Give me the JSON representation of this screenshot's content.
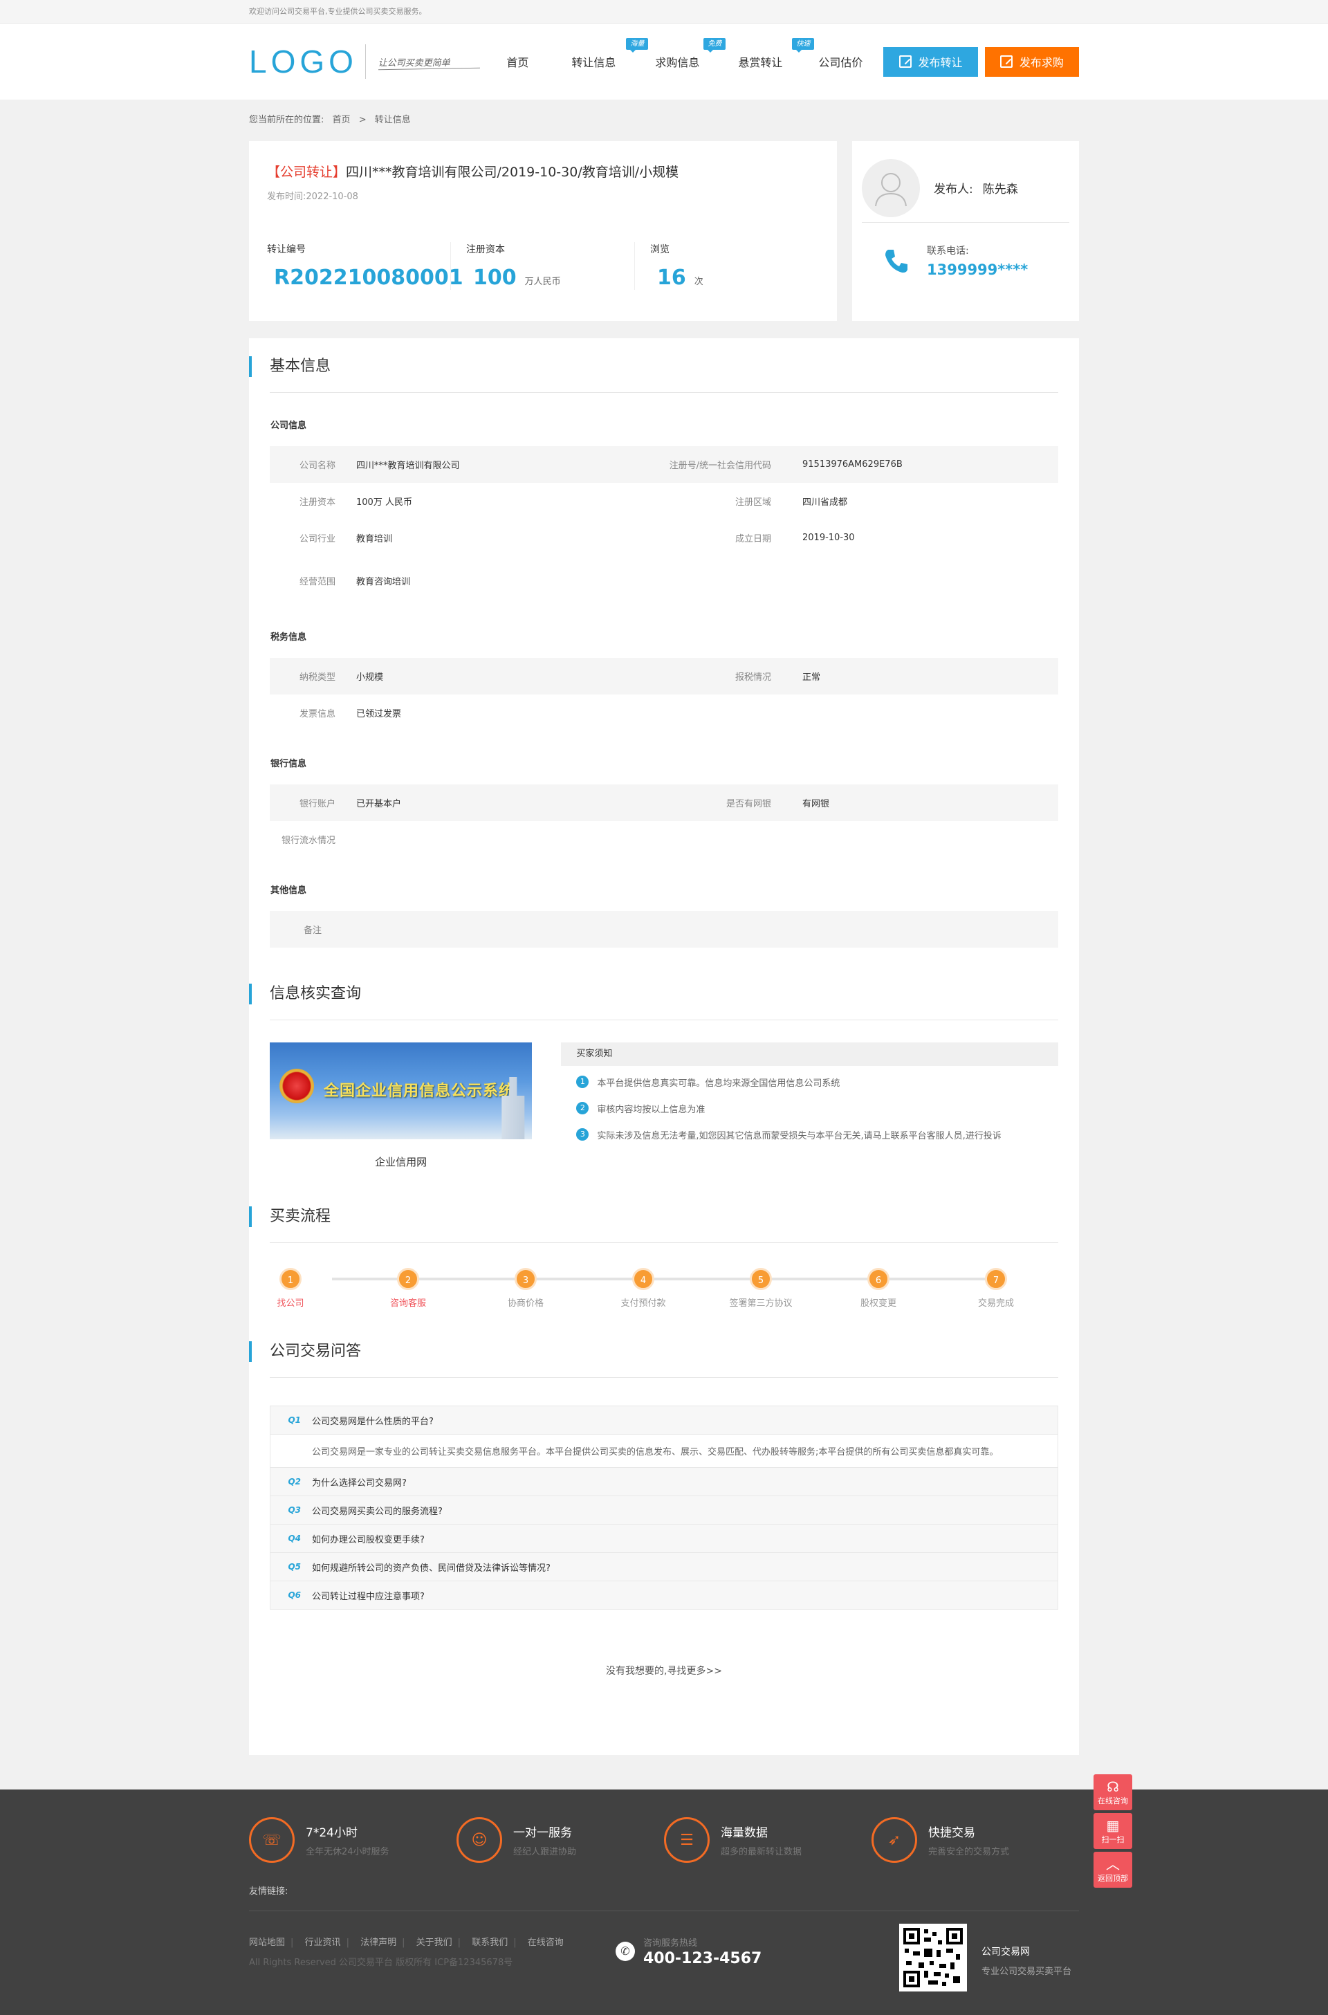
{
  "topbar": {
    "welcome": "欢迎访问公司交易平台,专业提供公司买卖交易服务。"
  },
  "header": {
    "logo": "LOGO",
    "slogan": "让公司买卖更简单",
    "nav": [
      {
        "label": "首页",
        "tag": ""
      },
      {
        "label": "转让信息",
        "tag": "海量"
      },
      {
        "label": "求购信息",
        "tag": "免费"
      },
      {
        "label": "悬赏转让",
        "tag": "快速"
      },
      {
        "label": "公司估价",
        "tag": ""
      }
    ],
    "btn_transfer": "发布转让",
    "btn_buy": "发布求购",
    "colors": {
      "blue": "#2ea7e0",
      "orange": "#ff7200"
    }
  },
  "breadcrumb": {
    "prefix": "您当前所在的位置:",
    "home": "首页",
    "sep": ">",
    "current": "转让信息"
  },
  "summary": {
    "type": "【公司转让】",
    "title": "四川***教育培训有限公司/2019-10-30/教育培训/小规模",
    "date": "发布时间:2022-10-08",
    "stats": [
      {
        "label": "转让编号",
        "value": "R202210080001",
        "unit": ""
      },
      {
        "label": "注册资本",
        "value": "100",
        "unit": "万人民币"
      },
      {
        "label": "浏览",
        "value": "16",
        "unit": "次"
      }
    ],
    "publisher_label": "发布人:",
    "publisher": "陈先森",
    "phone_label": "联系电话:",
    "phone": "1399999****"
  },
  "basic": {
    "title": "基本信息",
    "company_h": "公司信息",
    "company": [
      {
        "k": "公司名称",
        "v": "四川***教育培训有限公司",
        "k2": "注册号/统一社会信用代码",
        "v2": "91513976AM629E76B"
      },
      {
        "k": "注册资本",
        "v": "100万 人民币",
        "k2": "注册区域",
        "v2": "四川省成都"
      },
      {
        "k": "公司行业",
        "v": "教育培训",
        "k2": "成立日期",
        "v2": "2019-10-30"
      },
      {
        "k": "经营范围",
        "v": "教育咨询培训",
        "k2": "",
        "v2": ""
      }
    ],
    "tax_h": "税务信息",
    "tax": [
      {
        "k": "纳税类型",
        "v": "小规模",
        "k2": "报税情况",
        "v2": "正常"
      },
      {
        "k": "发票信息",
        "v": "已领过发票",
        "k2": "",
        "v2": ""
      }
    ],
    "bank_h": "银行信息",
    "bank": [
      {
        "k": "银行账户",
        "v": "已开基本户",
        "k2": "是否有网银",
        "v2": "有网银"
      },
      {
        "k": "银行流水情况",
        "v": "",
        "k2": "",
        "v2": ""
      }
    ],
    "other_h": "其他信息",
    "other": [
      {
        "k": "备注",
        "v": "",
        "k2": "",
        "v2": ""
      }
    ]
  },
  "verify": {
    "title": "信息核实查询",
    "banner_text": "全国企业信用信息公示系统",
    "caption": "企业信用网",
    "notice_h": "买家须知",
    "notices": [
      "本平台提供信息真实可靠。信息均来源全国信用信息公司系统",
      "审核内容均按以上信息为准",
      "实际未涉及信息无法考量,如您因其它信息而蒙受损失与本平台无关,请马上联系平台客服人员,进行投诉"
    ]
  },
  "flow": {
    "title": "买卖流程",
    "steps": [
      {
        "n": "1",
        "label": "找公司",
        "color": "#f0565d"
      },
      {
        "n": "2",
        "label": "咨询客服",
        "color": "#f0565d"
      },
      {
        "n": "3",
        "label": "协商价格",
        "color": "#999999"
      },
      {
        "n": "4",
        "label": "支付预付款",
        "color": "#999999"
      },
      {
        "n": "5",
        "label": "签署第三方协议",
        "color": "#999999"
      },
      {
        "n": "6",
        "label": "股权变更",
        "color": "#999999"
      },
      {
        "n": "7",
        "label": "交易完成",
        "color": "#999999"
      }
    ]
  },
  "faq": {
    "title": "公司交易问答",
    "items": [
      {
        "n": "Q1",
        "q": "公司交易网是什么性质的平台?",
        "a": "公司交易网是一家专业的公司转让买卖交易信息服务平台。本平台提供公司买卖的信息发布、展示、交易匹配、代办股转等服务;本平台提供的所有公司买卖信息都真实可靠。"
      },
      {
        "n": "Q2",
        "q": "为什么选择公司交易网?",
        "a": ""
      },
      {
        "n": "Q3",
        "q": "公司交易网买卖公司的服务流程?",
        "a": ""
      },
      {
        "n": "Q4",
        "q": "如何办理公司股权变更手续?",
        "a": ""
      },
      {
        "n": "Q5",
        "q": "如何规避所转公司的资产负债、民间借贷及法律诉讼等情况?",
        "a": ""
      },
      {
        "n": "Q6",
        "q": "公司转让过程中应注意事项?",
        "a": ""
      }
    ],
    "more": "没有我想要的,寻找更多>>"
  },
  "footer": {
    "features": [
      {
        "icon": "24h-icon",
        "t1": "7*24小时",
        "t2": "全年无休24小时服务"
      },
      {
        "icon": "user-icon",
        "t1": "一对一服务",
        "t2": "经纪人跟进协助"
      },
      {
        "icon": "database-icon",
        "t1": "海量数据",
        "t2": "超多的最新转让数据"
      },
      {
        "icon": "rocket-icon",
        "t1": "快捷交易",
        "t2": "完善安全的交易方式"
      }
    ],
    "links_h": "友情链接:",
    "nav": [
      "网站地图",
      "行业资讯",
      "法律声明",
      "关于我们",
      "联系我们",
      "在线咨询"
    ],
    "copyright": "All Rights Reserved 公司交易平台 版权所有 ICP备12345678号",
    "hotline_label": "咨询服务热线",
    "hotline": "400-123-4567",
    "brand": "公司交易网",
    "brand_sub": "专业公司交易买卖平台"
  },
  "side": {
    "chat": "在线咨询",
    "scan": "扫一扫",
    "top": "返回顶部"
  }
}
